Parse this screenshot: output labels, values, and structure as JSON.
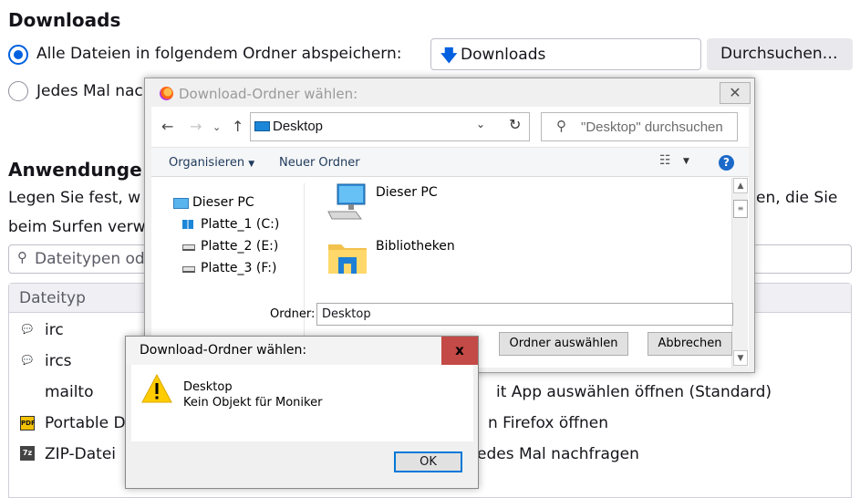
{
  "settings": {
    "downloads_heading": "Downloads",
    "save_all_label": "Alle Dateien in folgendem Ordner abspeichern:",
    "folder_value": "Downloads",
    "browse_label": "Durchsuchen…",
    "ask_label": "Jedes Mal nac",
    "apps_heading": "Anwendunge",
    "apps_desc_1": "Legen Sie fest, w",
    "apps_desc_1_end": "en, die Sie",
    "apps_desc_2": "beim Surfen verw",
    "search_placeholder": "Dateitypen od",
    "col_type": "Dateityp",
    "rows": [
      {
        "type": "irc",
        "action": ""
      },
      {
        "type": "ircs",
        "action": ""
      },
      {
        "type": "mailto",
        "action": "it App auswählen öffnen (Standard)"
      },
      {
        "type": "Portable D",
        "action": "n Firefox öffnen"
      },
      {
        "type": "ZIP-Datei",
        "action": "edes Mal nachfragen"
      }
    ]
  },
  "picker": {
    "title": "Download-Ordner wählen:",
    "close_glyph": "✕",
    "address": "Desktop",
    "search_placeholder": "\"Desktop\" durchsuchen",
    "organize": "Organisieren",
    "new_folder": "Neuer Ordner",
    "help": "?",
    "tree": [
      "Dieser PC",
      "Platte_1 (C:)",
      "Platte_2 (E:)",
      "Platte_3 (F:)"
    ],
    "items": [
      "Dieser PC",
      "Bibliotheken"
    ],
    "folder_label": "Ordner:",
    "folder_value": "Desktop",
    "select_button": "Ordner auswählen",
    "cancel_button": "Abbrechen"
  },
  "message": {
    "title": "Download-Ordner wählen:",
    "close_glyph": "x",
    "line1": "Desktop",
    "line2": "Kein Objekt für Moniker",
    "ok_button": "OK"
  },
  "colors": {
    "accent": "#0060df",
    "close_red": "#c34a46",
    "warning_yellow": "#ffcc00"
  }
}
